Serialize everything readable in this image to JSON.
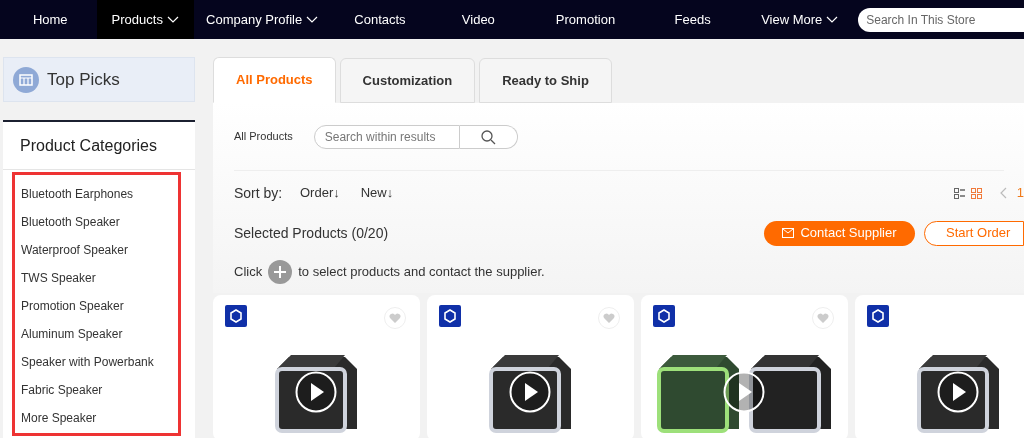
{
  "nav": {
    "items": [
      {
        "label": "Home",
        "selected": false,
        "dropdown": false
      },
      {
        "label": "Products",
        "selected": true,
        "dropdown": true
      },
      {
        "label": "Company Profile",
        "selected": false,
        "dropdown": true
      },
      {
        "label": "Contacts",
        "selected": false,
        "dropdown": false
      },
      {
        "label": "Video",
        "selected": false,
        "dropdown": false
      },
      {
        "label": "Promotion",
        "selected": false,
        "dropdown": false
      },
      {
        "label": "Feeds",
        "selected": false,
        "dropdown": false
      },
      {
        "label": "View More",
        "selected": false,
        "dropdown": true
      }
    ],
    "search": {
      "placeholder": "Search In This Store"
    }
  },
  "sidebar": {
    "top_picks": "Top Picks",
    "categories_title": "Product Categories",
    "categories": [
      "Bluetooth Earphones",
      "Bluetooth Speaker",
      "Waterproof Speaker",
      "TWS Speaker",
      "Promotion Speaker",
      "Aluminum Speaker",
      "Speaker with Powerbank",
      "Fabric Speaker",
      "More Speaker"
    ]
  },
  "tabs": [
    {
      "label": "All Products",
      "selected": true
    },
    {
      "label": "Customization",
      "selected": false
    },
    {
      "label": "Ready to Ship",
      "selected": false
    }
  ],
  "filter": {
    "label": "All Products",
    "search_placeholder": "Search within results"
  },
  "sort": {
    "label": "Sort by:",
    "options": [
      "Order↓",
      "New↓"
    ],
    "page": "1"
  },
  "selection": {
    "text": "Selected Products (0/20)",
    "contact_button": "Contact Supplier",
    "order_button": "Start Order",
    "hint_before": "Click",
    "hint_after": "to select products and contact the supplier."
  },
  "products": [
    {
      "kind": "single"
    },
    {
      "kind": "single"
    },
    {
      "kind": "pair"
    },
    {
      "kind": "single"
    }
  ]
}
